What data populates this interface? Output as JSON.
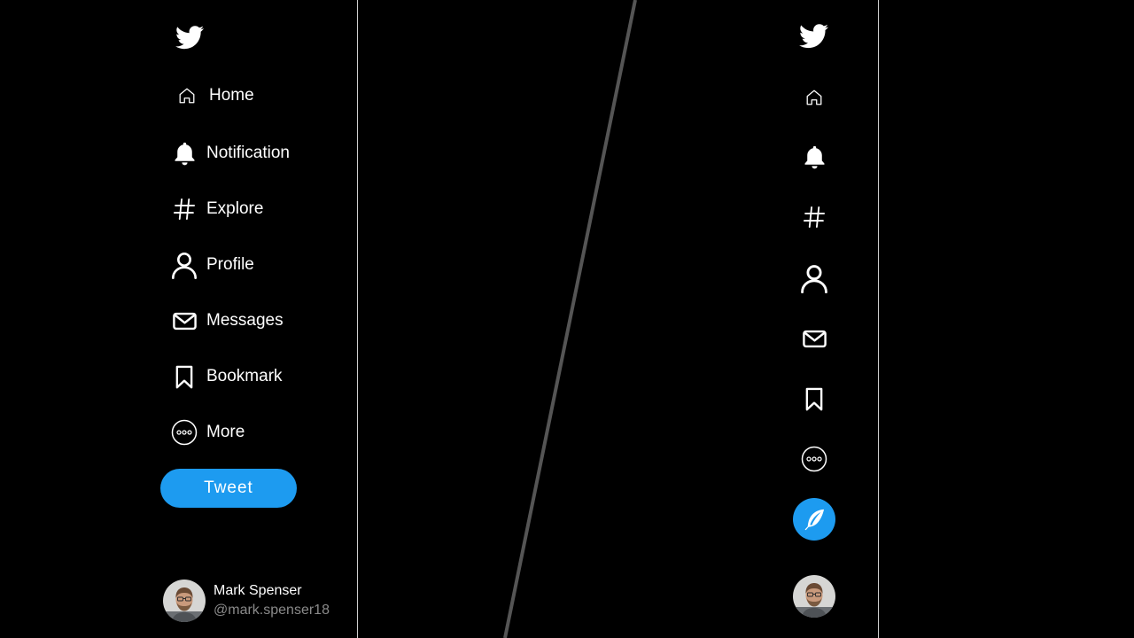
{
  "nav": [
    {
      "id": "home",
      "label": "Home",
      "icon": "home-icon"
    },
    {
      "id": "notification",
      "label": "Notification",
      "icon": "bell-icon"
    },
    {
      "id": "explore",
      "label": "Explore",
      "icon": "hashtag-icon"
    },
    {
      "id": "profile",
      "label": "Profile",
      "icon": "person-icon"
    },
    {
      "id": "messages",
      "label": "Messages",
      "icon": "envelope-icon"
    },
    {
      "id": "bookmark",
      "label": "Bookmark",
      "icon": "bookmark-icon"
    },
    {
      "id": "more",
      "label": "More",
      "icon": "more-circle-icon"
    }
  ],
  "tweet_label": "Tweet",
  "user": {
    "name": "Mark Spenser",
    "handle": "@mark.spenser18"
  },
  "colors": {
    "background": "#000000",
    "accent": "#1d9bf0",
    "text": "#ffffff",
    "muted": "#8a8a8a"
  }
}
